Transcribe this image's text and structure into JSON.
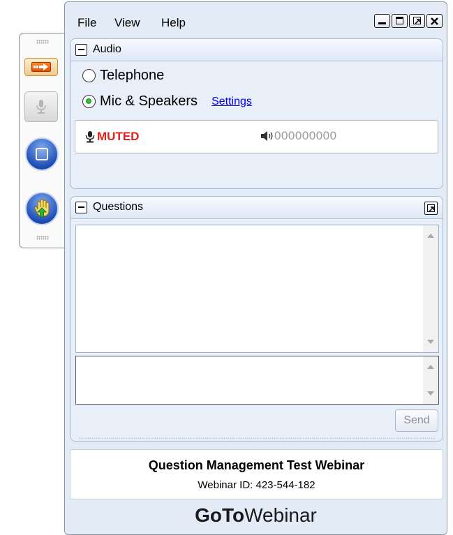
{
  "menu": {
    "file": "File",
    "view": "View",
    "help": "Help"
  },
  "window_controls": [
    "minimize-icon",
    "maximize-icon",
    "restore-icon",
    "close-icon"
  ],
  "toolbar": {
    "icons": [
      "arrow-right-icon",
      "microphone-icon",
      "screen-share-icon",
      "raise-hand-icon"
    ]
  },
  "audio": {
    "title": "Audio",
    "options": [
      {
        "label": "Telephone",
        "selected": false
      },
      {
        "label": "Mic & Speakers",
        "selected": true
      }
    ],
    "settings_link": "Settings",
    "status": "MUTED",
    "level_meter": "000000000"
  },
  "questions": {
    "title": "Questions",
    "send_label": "Send"
  },
  "webinar": {
    "title": "Question Management Test Webinar",
    "id_line": "Webinar ID: 423-544-182"
  },
  "brand": {
    "part1": "GoTo",
    "part2": "Webinar"
  },
  "colors": {
    "muted": "#e0201c",
    "link": "#0000ee",
    "panel_bg": "#e8eff8",
    "accent_orange": "#f26a10",
    "accent_blue": "#1e4fb5"
  }
}
